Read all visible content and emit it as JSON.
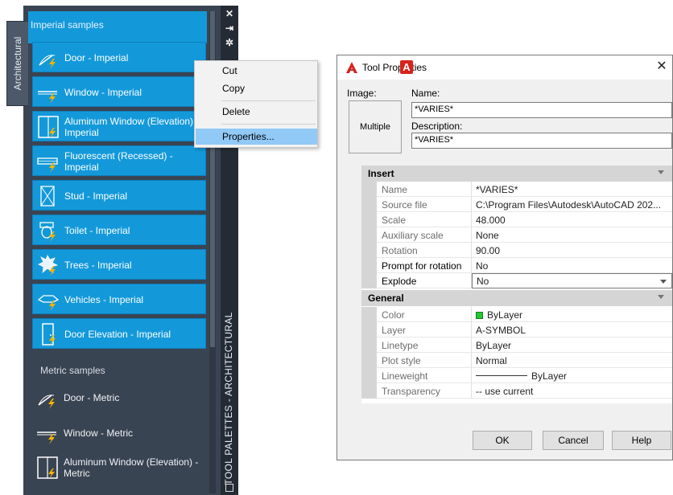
{
  "palette": {
    "tab_label": "Architectural",
    "side_label": "TOOL PALETTES - ARCHITECTURAL",
    "controls": [
      "close-icon",
      "autohide-icon",
      "properties-icon"
    ],
    "imperial_header": "Imperial samples",
    "imperial_tools": [
      {
        "label": "Door - Imperial",
        "icon": "door-icon"
      },
      {
        "label": "Window - Imperial",
        "icon": "window-icon"
      },
      {
        "label": "Aluminum Window (Elevation) - Imperial",
        "icon": "aluminum-window-icon"
      },
      {
        "label": "Fluorescent (Recessed) - Imperial",
        "icon": "fluorescent-icon"
      },
      {
        "label": "Stud - Imperial",
        "icon": "stud-icon"
      },
      {
        "label": "Toilet - Imperial",
        "icon": "toilet-icon"
      },
      {
        "label": "Trees - Imperial",
        "icon": "trees-icon"
      },
      {
        "label": "Vehicles - Imperial",
        "icon": "vehicles-icon"
      },
      {
        "label": "Door Elevation - Imperial",
        "icon": "door-elevation-icon"
      }
    ],
    "metric_header": "Metric samples",
    "metric_tools": [
      {
        "label": "Door - Metric",
        "icon": "door-icon"
      },
      {
        "label": "Window - Metric",
        "icon": "window-icon"
      },
      {
        "label": "Aluminum Window (Elevation) - Metric",
        "icon": "aluminum-window-icon"
      }
    ]
  },
  "context_menu": {
    "items": [
      "Cut",
      "Copy",
      "Delete",
      "Properties..."
    ],
    "selected": "Properties..."
  },
  "dialog": {
    "title": "Tool Properties",
    "overlay_letter": "A",
    "image_label": "Image:",
    "image_value": "Multiple",
    "name_label": "Name:",
    "name_value": "*VARIES*",
    "description_label": "Description:",
    "description_value": "*VARIES*",
    "insert_category": "Insert",
    "insert_props": [
      {
        "name": "Name",
        "value": "*VARIES*"
      },
      {
        "name": "Source file",
        "value": "C:\\Program Files\\Autodesk\\AutoCAD 202..."
      },
      {
        "name": "Scale",
        "value": "48.000"
      },
      {
        "name": "Auxiliary scale",
        "value": "None"
      },
      {
        "name": "Rotation",
        "value": "90.00"
      },
      {
        "name": "Prompt for rotation",
        "value": "No"
      },
      {
        "name": "Explode",
        "value": "No"
      }
    ],
    "general_category": "General",
    "general_props": [
      {
        "name": "Color",
        "value": "ByLayer"
      },
      {
        "name": "Layer",
        "value": "A-SYMBOL"
      },
      {
        "name": "Linetype",
        "value": "ByLayer"
      },
      {
        "name": "Plot style",
        "value": "Normal"
      },
      {
        "name": "Lineweight",
        "value": "ByLayer"
      },
      {
        "name": "Transparency",
        "value": "-- use current"
      }
    ],
    "ok_label": "OK",
    "cancel_label": "Cancel",
    "help_label": "Help"
  },
  "colors": {
    "palette_bg": "#394453",
    "tool_blue": "#1399da",
    "menu_highlight": "#91c9f7",
    "color_swatch": "#22c832",
    "autocad_red": "#d6231c"
  }
}
